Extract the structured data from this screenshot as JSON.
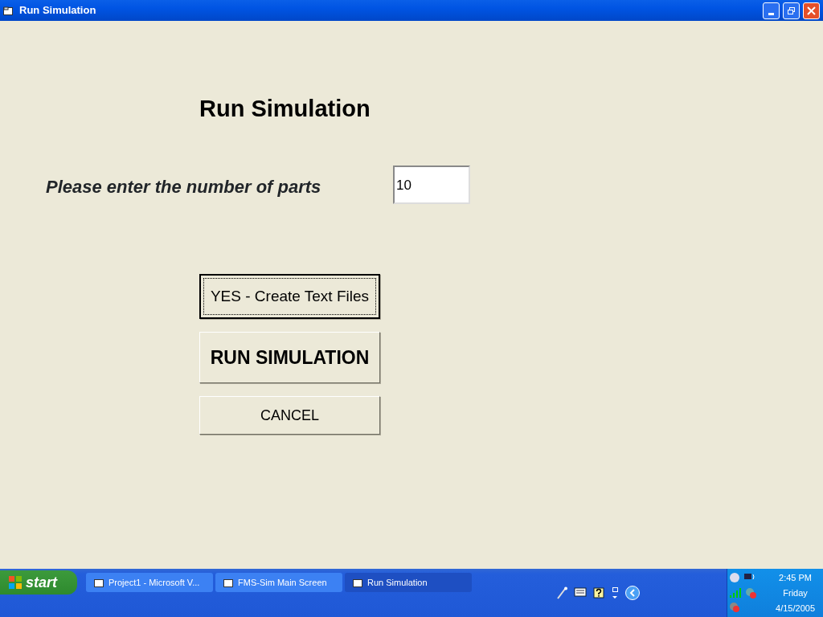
{
  "window": {
    "title": "Run Simulation"
  },
  "form": {
    "heading": "Run Simulation",
    "prompt": "Please enter the number of parts",
    "parts_value": "10"
  },
  "buttons": [
    {
      "label": "YES - Create Text Files",
      "kind": "normal",
      "focused": true
    },
    {
      "label": "RUN SIMULATION",
      "kind": "large",
      "focused": false
    },
    {
      "label": "CANCEL",
      "kind": "small",
      "focused": false
    }
  ],
  "taskbar": {
    "start": "start",
    "tasks": [
      {
        "label": "Project1 - Microsoft V...",
        "selected": false
      },
      {
        "label": "FMS-Sim Main Screen",
        "selected": false
      },
      {
        "label": "Run Simulation",
        "selected": true
      }
    ],
    "clock": {
      "time": "2:45 PM",
      "day": "Friday",
      "date": "4/15/2005"
    }
  }
}
